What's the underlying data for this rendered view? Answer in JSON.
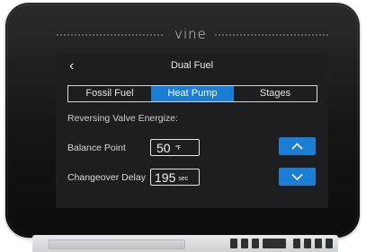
{
  "brand": {
    "logo_text": "vine"
  },
  "header": {
    "back_icon": "chevron-left-icon",
    "title": "Dual Fuel"
  },
  "tabs": [
    {
      "label": "Fossil Fuel",
      "active": false
    },
    {
      "label": "Heat Pump",
      "active": true
    },
    {
      "label": "Stages",
      "active": false
    }
  ],
  "section": {
    "label": "Reversing Valve Energize:"
  },
  "balance_point": {
    "label": "Balance Point",
    "value": "50",
    "unit": "℉"
  },
  "changeover_delay": {
    "label": "Changeover Delay",
    "value": "195",
    "unit": "sec"
  },
  "controls": {
    "up_icon": "chevron-up-icon",
    "down_icon": "chevron-down-icon"
  },
  "colors": {
    "accent": "#1a7fd4",
    "screen_bg": "#1e1e20",
    "text": "#e8e8ea"
  }
}
